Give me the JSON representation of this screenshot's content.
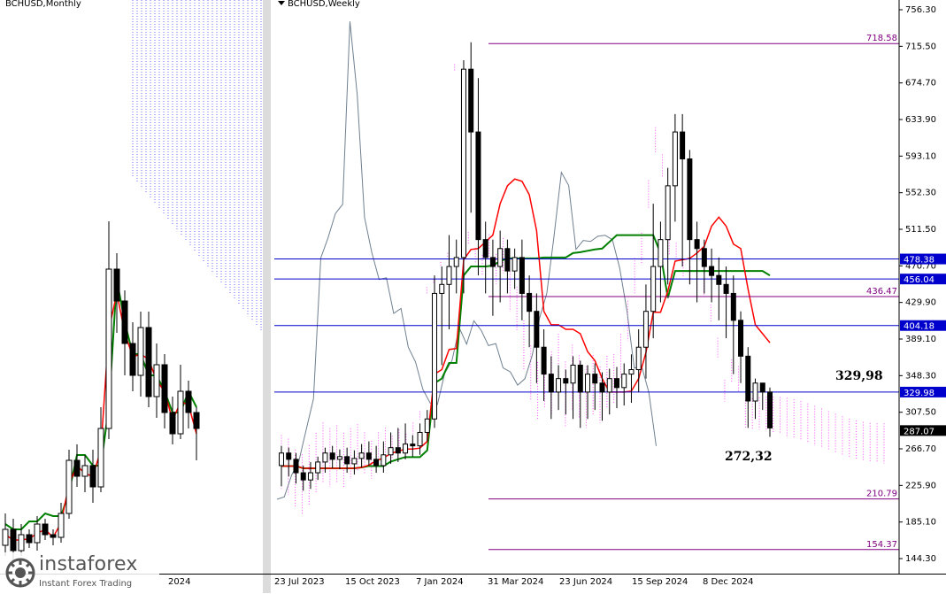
{
  "left_chart": {
    "title": "BCHUSD,Monthly",
    "date_label": "2024"
  },
  "right_chart": {
    "title": "BCHUSD,Weekly",
    "annotations": {
      "resistance_label": "329,98",
      "low_label": "272,32"
    }
  },
  "date_axis_labels": [
    "23 Jul 2023",
    "15 Oct 2023",
    "7 Jan 2024",
    "31 Mar 2024",
    "23 Jun 2024",
    "15 Sep 2024",
    "8 Dec 2024"
  ],
  "logo": {
    "name": "instaforex",
    "tagline": "Instant Forex Trading"
  },
  "colors": {
    "tenkan": "#ff0000",
    "kijun": "#008000",
    "chikou": "#708090",
    "kumo": "#ff00ff",
    "kumo_bear": "#0000ff",
    "level_line": "#0000cd",
    "fib_line": "#800080",
    "price_box": "#000000"
  },
  "chart_data": {
    "type": "candlestick",
    "title": "BCHUSD,Weekly",
    "ylim": [
      144.3,
      756.3
    ],
    "y_ticks": [
      "756.30",
      "715.50",
      "674.70",
      "633.90",
      "593.10",
      "552.30",
      "511.50",
      "470.70",
      "429.90",
      "389.10",
      "348.30",
      "307.50",
      "266.70",
      "225.90",
      "185.10",
      "144.30"
    ],
    "horizontal_levels": [
      {
        "label": "718.58",
        "value": 718.58,
        "style": "fib"
      },
      {
        "label": "478.38",
        "value": 478.38,
        "style": "level"
      },
      {
        "label": "456.04",
        "value": 456.04,
        "style": "level"
      },
      {
        "label": "436.47",
        "value": 436.47,
        "style": "fib"
      },
      {
        "label": "404.18",
        "value": 404.18,
        "style": "level"
      },
      {
        "label": "329.98",
        "value": 329.98,
        "style": "level"
      },
      {
        "label": "210.79",
        "value": 210.79,
        "style": "fib"
      },
      {
        "label": "154.37",
        "value": 154.37,
        "style": "fib"
      }
    ],
    "current_price": {
      "label": "287.07",
      "value": 287.07
    },
    "candles": [
      [
        248,
        262,
        230,
        270,
        225
      ],
      [
        262,
        255,
        240,
        268,
        236
      ],
      [
        255,
        240,
        235,
        262,
        228
      ],
      [
        240,
        232,
        228,
        248,
        220
      ],
      [
        232,
        240,
        230,
        252,
        222
      ],
      [
        240,
        252,
        236,
        258,
        232
      ],
      [
        252,
        262,
        248,
        268,
        240
      ],
      [
        262,
        255,
        250,
        270,
        245
      ],
      [
        255,
        258,
        250,
        266,
        244
      ],
      [
        258,
        250,
        248,
        268,
        240
      ],
      [
        250,
        256,
        245,
        265,
        238
      ],
      [
        256,
        262,
        250,
        272,
        246
      ],
      [
        262,
        255,
        252,
        275,
        248
      ],
      [
        255,
        248,
        245,
        270,
        240
      ],
      [
        248,
        260,
        245,
        275,
        240
      ],
      [
        260,
        268,
        255,
        285,
        250
      ],
      [
        268,
        262,
        258,
        290,
        252
      ],
      [
        262,
        272,
        258,
        295,
        255
      ],
      [
        272,
        270,
        262,
        282,
        258
      ],
      [
        270,
        285,
        265,
        295,
        260
      ],
      [
        285,
        300,
        278,
        310,
        275
      ],
      [
        300,
        440,
        295,
        460,
        290
      ],
      [
        440,
        450,
        380,
        470,
        360
      ],
      [
        450,
        470,
        420,
        505,
        400
      ],
      [
        470,
        480,
        460,
        500,
        440
      ],
      [
        480,
        690,
        460,
        700,
        440
      ],
      [
        690,
        620,
        560,
        720,
        530
      ],
      [
        620,
        500,
        480,
        680,
        460
      ],
      [
        500,
        480,
        460,
        520,
        440
      ],
      [
        480,
        470,
        420,
        500,
        415
      ],
      [
        470,
        490,
        450,
        510,
        430
      ],
      [
        490,
        465,
        450,
        500,
        440
      ],
      [
        465,
        480,
        455,
        490,
        445
      ],
      [
        480,
        440,
        420,
        500,
        410
      ],
      [
        440,
        420,
        400,
        460,
        380
      ],
      [
        420,
        380,
        360,
        440,
        340
      ],
      [
        380,
        350,
        340,
        400,
        320
      ],
      [
        350,
        330,
        320,
        370,
        300
      ],
      [
        330,
        345,
        325,
        360,
        310
      ],
      [
        345,
        340,
        318,
        355,
        305
      ],
      [
        340,
        360,
        320,
        370,
        300
      ],
      [
        360,
        330,
        310,
        365,
        290
      ],
      [
        330,
        350,
        320,
        360,
        300
      ],
      [
        350,
        340,
        325,
        362,
        310
      ],
      [
        340,
        330,
        310,
        352,
        298
      ],
      [
        330,
        345,
        315,
        356,
        305
      ],
      [
        345,
        335,
        322,
        358,
        312
      ],
      [
        335,
        350,
        325,
        362,
        315
      ],
      [
        350,
        355,
        335,
        372,
        318
      ],
      [
        355,
        380,
        345,
        400,
        330
      ],
      [
        380,
        420,
        360,
        450,
        345
      ],
      [
        420,
        470,
        400,
        540,
        390
      ],
      [
        470,
        500,
        450,
        520,
        430
      ],
      [
        500,
        560,
        480,
        580,
        450
      ],
      [
        560,
        620,
        540,
        640,
        520
      ],
      [
        620,
        590,
        480,
        640,
        470
      ],
      [
        590,
        500,
        460,
        600,
        450
      ],
      [
        500,
        490,
        440,
        520,
        430
      ],
      [
        490,
        470,
        450,
        500,
        440
      ],
      [
        470,
        460,
        440,
        490,
        430
      ],
      [
        460,
        450,
        420,
        480,
        410
      ],
      [
        450,
        440,
        400,
        470,
        390
      ],
      [
        440,
        410,
        360,
        460,
        350
      ],
      [
        410,
        370,
        350,
        420,
        340
      ],
      [
        370,
        320,
        300,
        380,
        290
      ],
      [
        320,
        340,
        310,
        345,
        300
      ],
      [
        340,
        330,
        315,
        340,
        310
      ],
      [
        330,
        290,
        285,
        335,
        280
      ]
    ]
  }
}
